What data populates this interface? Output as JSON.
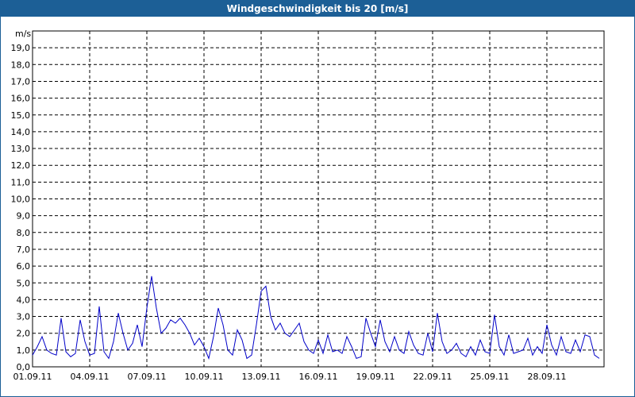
{
  "window": {
    "title": "Windgeschwindigkeit bis 20 [m/s]"
  },
  "colors": {
    "titlebar": "#1c5f96",
    "line": "#0000c8",
    "grid": "#000000",
    "background": "#ffffff"
  },
  "chart_data": {
    "type": "line",
    "title": "Windgeschwindigkeit bis 20 [m/s]",
    "ylabel": "m/s",
    "xlabel": "",
    "ylim": [
      0,
      20
    ],
    "xlim": [
      "01.09.11",
      "30.09.11"
    ],
    "grid": true,
    "x_tick_labels": [
      "01.09.11",
      "04.09.11",
      "07.09.11",
      "10.09.11",
      "13.09.11",
      "16.09.11",
      "19.09.11",
      "22.09.11",
      "25.09.11",
      "28.09.11"
    ],
    "y_tick_labels": [
      "0,0",
      "1,0",
      "2,0",
      "3,0",
      "4,0",
      "5,0",
      "6,0",
      "7,0",
      "8,0",
      "9,0",
      "10,0",
      "11,0",
      "12,0",
      "13,0",
      "14,0",
      "15,0",
      "16,0",
      "17,0",
      "18,0",
      "19,0"
    ],
    "series": [
      {
        "x": [
          "01.09.11 00:00",
          "01.09.11 06:00",
          "01.09.11 12:00",
          "01.09.11 18:00",
          "02.09.11 00:00",
          "02.09.11 06:00",
          "02.09.11 12:00",
          "02.09.11 18:00",
          "03.09.11 00:00",
          "03.09.11 06:00",
          "03.09.11 12:00",
          "03.09.11 18:00",
          "04.09.11 00:00",
          "04.09.11 06:00",
          "04.09.11 12:00",
          "04.09.11 18:00",
          "05.09.11 00:00",
          "05.09.11 06:00",
          "05.09.11 12:00",
          "05.09.11 18:00",
          "06.09.11 00:00",
          "06.09.11 06:00",
          "06.09.11 12:00",
          "06.09.11 18:00",
          "07.09.11 00:00",
          "07.09.11 06:00",
          "07.09.11 12:00",
          "07.09.11 18:00",
          "08.09.11 00:00",
          "08.09.11 06:00",
          "08.09.11 12:00",
          "08.09.11 18:00",
          "09.09.11 00:00",
          "09.09.11 06:00",
          "09.09.11 12:00",
          "09.09.11 18:00",
          "10.09.11 00:00",
          "10.09.11 06:00",
          "10.09.11 12:00",
          "10.09.11 18:00",
          "11.09.11 00:00",
          "11.09.11 06:00",
          "11.09.11 12:00",
          "11.09.11 18:00",
          "12.09.11 00:00",
          "12.09.11 06:00",
          "12.09.11 12:00",
          "12.09.11 18:00",
          "13.09.11 00:00",
          "13.09.11 06:00",
          "13.09.11 12:00",
          "13.09.11 18:00",
          "14.09.11 00:00",
          "14.09.11 06:00",
          "14.09.11 12:00",
          "14.09.11 18:00",
          "15.09.11 00:00",
          "15.09.11 06:00",
          "15.09.11 12:00",
          "15.09.11 18:00",
          "16.09.11 00:00",
          "16.09.11 06:00",
          "16.09.11 12:00",
          "16.09.11 18:00",
          "17.09.11 00:00",
          "17.09.11 06:00",
          "17.09.11 12:00",
          "17.09.11 18:00",
          "18.09.11 00:00",
          "18.09.11 06:00",
          "18.09.11 12:00",
          "18.09.11 18:00",
          "19.09.11 00:00",
          "19.09.11 06:00",
          "19.09.11 12:00",
          "19.09.11 18:00",
          "20.09.11 00:00",
          "20.09.11 06:00",
          "20.09.11 12:00",
          "20.09.11 18:00",
          "21.09.11 00:00",
          "21.09.11 06:00",
          "21.09.11 12:00",
          "21.09.11 18:00",
          "22.09.11 00:00",
          "22.09.11 06:00",
          "22.09.11 12:00",
          "22.09.11 18:00",
          "23.09.11 00:00",
          "23.09.11 06:00",
          "23.09.11 12:00",
          "23.09.11 18:00",
          "24.09.11 00:00",
          "24.09.11 06:00",
          "24.09.11 12:00",
          "24.09.11 18:00",
          "25.09.11 00:00",
          "25.09.11 06:00",
          "25.09.11 12:00",
          "25.09.11 18:00",
          "26.09.11 00:00",
          "26.09.11 06:00",
          "26.09.11 12:00",
          "26.09.11 18:00",
          "27.09.11 00:00",
          "27.09.11 06:00",
          "27.09.11 12:00",
          "27.09.11 18:00",
          "28.09.11 00:00",
          "28.09.11 06:00",
          "28.09.11 12:00",
          "28.09.11 18:00",
          "29.09.11 00:00",
          "29.09.11 06:00",
          "29.09.11 12:00",
          "29.09.11 18:00",
          "30.09.11 00:00",
          "30.09.11 06:00",
          "30.09.11 12:00",
          "30.09.11 18:00"
        ],
        "values": [
          0.7,
          1.2,
          1.8,
          1.0,
          0.8,
          0.7,
          2.9,
          0.9,
          0.6,
          0.8,
          2.8,
          1.5,
          0.7,
          0.8,
          3.6,
          0.9,
          0.5,
          1.5,
          3.2,
          2.0,
          1.0,
          1.4,
          2.5,
          1.2,
          3.5,
          5.4,
          3.5,
          2.0,
          2.3,
          2.8,
          2.6,
          2.9,
          2.5,
          2.0,
          1.3,
          1.7,
          1.2,
          0.5,
          1.8,
          3.5,
          2.5,
          1.0,
          0.7,
          2.2,
          1.6,
          0.5,
          0.7,
          2.5,
          4.5,
          4.8,
          3.0,
          2.2,
          2.6,
          2.0,
          1.8,
          2.2,
          2.6,
          1.5,
          1.0,
          0.8,
          1.6,
          0.8,
          1.9,
          0.9,
          1.0,
          0.8,
          1.8,
          1.2,
          0.5,
          0.6,
          2.9,
          2.0,
          1.2,
          2.8,
          1.5,
          0.9,
          1.8,
          1.0,
          0.8,
          2.1,
          1.3,
          0.8,
          0.7,
          2.0,
          0.9,
          3.2,
          1.5,
          0.8,
          1.0,
          1.4,
          0.8,
          0.6,
          1.2,
          0.7,
          1.6,
          0.9,
          0.8,
          3.1,
          1.2,
          0.7,
          1.9,
          0.8,
          0.9,
          1.0,
          1.7,
          0.7,
          1.2,
          0.8,
          2.5,
          1.3,
          0.7,
          1.8,
          0.9,
          0.8,
          1.6,
          0.9,
          1.9,
          1.8,
          0.7,
          0.5
        ]
      }
    ]
  }
}
